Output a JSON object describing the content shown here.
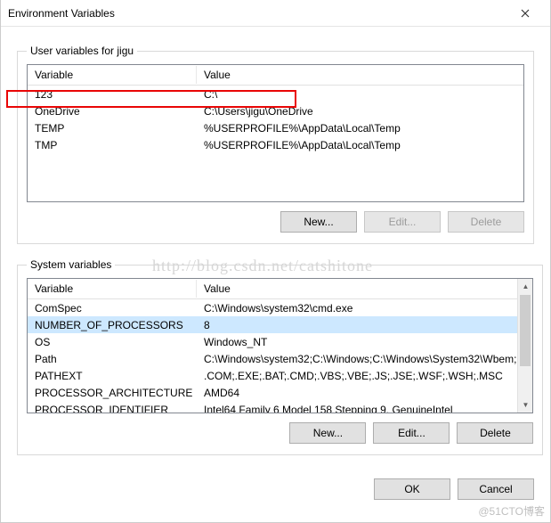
{
  "dialog": {
    "title": "Environment Variables"
  },
  "userVars": {
    "legend": "User variables for jigu",
    "headers": {
      "variable": "Variable",
      "value": "Value"
    },
    "rows": [
      {
        "name": "123",
        "value": "C:\\"
      },
      {
        "name": "OneDrive",
        "value": "C:\\Users\\jigu\\OneDrive"
      },
      {
        "name": "TEMP",
        "value": "%USERPROFILE%\\AppData\\Local\\Temp"
      },
      {
        "name": "TMP",
        "value": "%USERPROFILE%\\AppData\\Local\\Temp"
      }
    ],
    "buttons": {
      "new": "New...",
      "edit": "Edit...",
      "delete": "Delete"
    }
  },
  "sysVars": {
    "legend": "System variables",
    "headers": {
      "variable": "Variable",
      "value": "Value"
    },
    "rows": [
      {
        "name": "ComSpec",
        "value": "C:\\Windows\\system32\\cmd.exe"
      },
      {
        "name": "NUMBER_OF_PROCESSORS",
        "value": "8"
      },
      {
        "name": "OS",
        "value": "Windows_NT"
      },
      {
        "name": "Path",
        "value": "C:\\Windows\\system32;C:\\Windows;C:\\Windows\\System32\\Wbem;..."
      },
      {
        "name": "PATHEXT",
        "value": ".COM;.EXE;.BAT;.CMD;.VBS;.VBE;.JS;.JSE;.WSF;.WSH;.MSC"
      },
      {
        "name": "PROCESSOR_ARCHITECTURE",
        "value": "AMD64"
      },
      {
        "name": "PROCESSOR_IDENTIFIER",
        "value": "Intel64 Family 6 Model 158 Stepping 9, GenuineIntel"
      }
    ],
    "buttons": {
      "new": "New...",
      "edit": "Edit...",
      "delete": "Delete"
    }
  },
  "footer": {
    "ok": "OK",
    "cancel": "Cancel"
  },
  "watermark": "http://blog.csdn.net/catshitone",
  "cornermark": "@51CTO博客"
}
